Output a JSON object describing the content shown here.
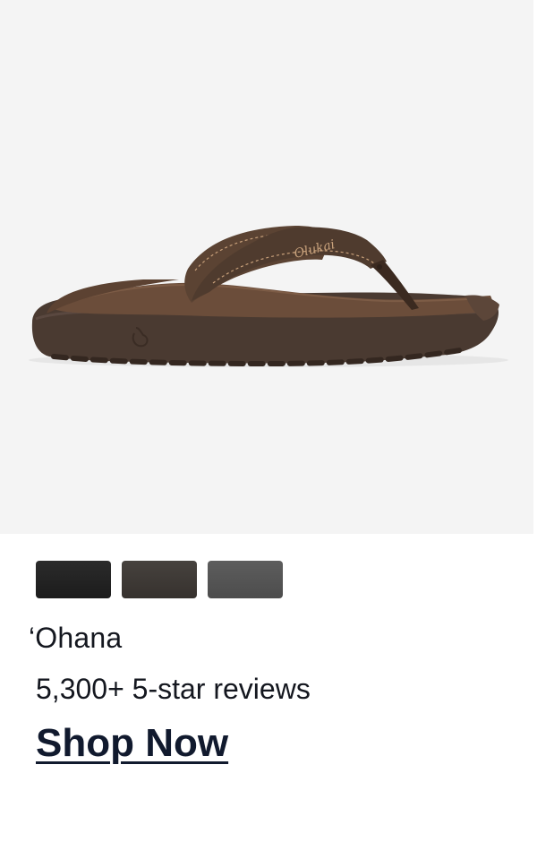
{
  "product": {
    "name": "‘Ohana",
    "reviews_text": "5,300+ 5-star reviews",
    "cta_label": "Shop Now",
    "image": {
      "subject": "sandal",
      "background_color": "#f4f4f4"
    },
    "swatches": [
      {
        "color": "#1e1e1e"
      },
      {
        "color": "#3b3632"
      },
      {
        "color": "#535353"
      }
    ],
    "colors": {
      "text": "#14171f",
      "cta": "#111a2e"
    }
  }
}
